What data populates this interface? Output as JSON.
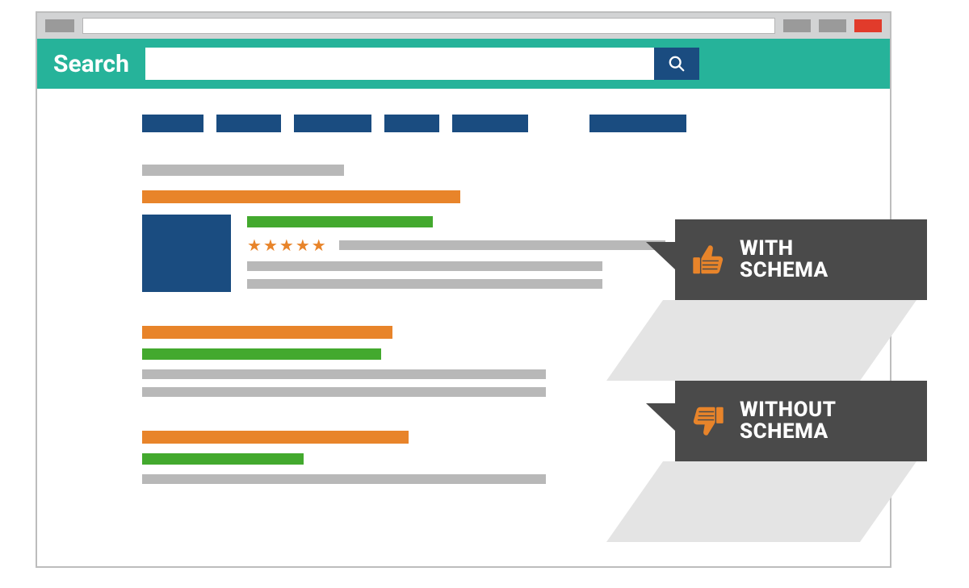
{
  "search": {
    "label": "Search"
  },
  "callouts": {
    "with": "WITH\nSCHEMA",
    "without": "WITHOUT\nSCHEMA"
  },
  "stars": {
    "count": 5
  },
  "icons": {
    "thumb_up": "thumbs-up-icon",
    "thumb_down": "thumbs-down-icon",
    "search": "search-icon"
  }
}
